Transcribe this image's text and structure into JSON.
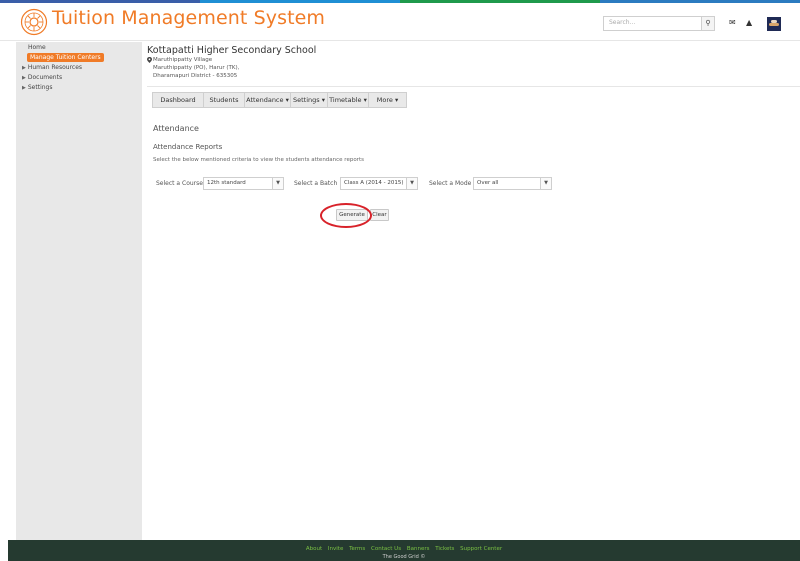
{
  "colors": {
    "brand": "#f07b27",
    "stripe": [
      "#3a5ea8",
      "#1f8fd4",
      "#1f9a4c",
      "#2b7bc0"
    ],
    "footer_bg": "#253a30",
    "footer_link": "#7ac143",
    "highlight": "#d8222a"
  },
  "header": {
    "title": "Tuition Management System",
    "logo_icon": "sun-emblem-icon",
    "search_placeholder": "Search...",
    "search_icon": "search-icon",
    "mail_icon": "envelope-icon",
    "bell_icon": "bell-icon"
  },
  "sidebar": {
    "items": [
      {
        "label": "Home"
      },
      {
        "label": "Manage Tuition  Centers",
        "active": true
      },
      {
        "label": "Human Resources",
        "expandable": true
      },
      {
        "label": "Documents",
        "expandable": true
      },
      {
        "label": "Settings",
        "expandable": true
      }
    ]
  },
  "school": {
    "name": "Kottapatti Higher Secondary School",
    "address": [
      "Maruthippatty Village",
      "Maruthippatty (PO), Harur (TK),",
      "Dharamapuri District - 635305"
    ]
  },
  "navbar": {
    "items": [
      {
        "label": "Dashboard"
      },
      {
        "label": "Students"
      },
      {
        "label": "Attendance ▾"
      },
      {
        "label": "Settings ▾"
      },
      {
        "label": "Timetable ▾"
      },
      {
        "label": "More ▾"
      }
    ]
  },
  "main": {
    "section_title": "Attendance",
    "subsection_title": "Attendance Reports",
    "hint": "Select the below mentioned criteria to view the students attendance reports",
    "filters": {
      "course_label": "Select a Course",
      "course_value": "12th standard",
      "batch_label": "Select a Batch",
      "batch_value": "Class A (2014 - 2015)",
      "mode_label": "Select a Mode",
      "mode_value": "Over all"
    },
    "generate_label": "Generate",
    "clear_label": "Clear"
  },
  "footer": {
    "links": [
      "About",
      "Invite",
      "Terms",
      "Contact Us",
      "Banners",
      "Tickets",
      "Support Center"
    ],
    "copyright": "The Good Grid ©"
  }
}
